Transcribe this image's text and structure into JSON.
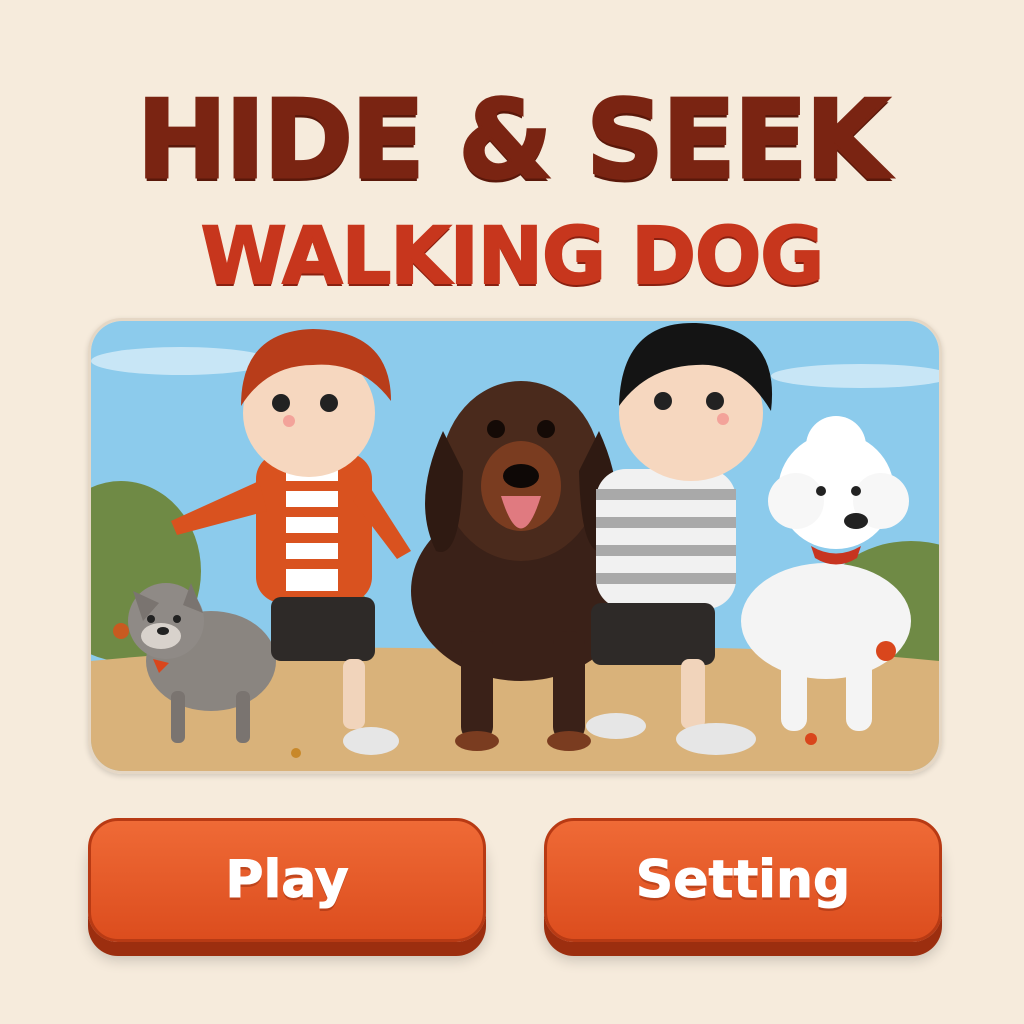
{
  "title": {
    "line1": "HIDE & SEEK",
    "line2": "WALKING DOG"
  },
  "buttons": {
    "play_label": "Play",
    "setting_label": "Setting"
  },
  "colors": {
    "background": "#f6ebdc",
    "title_line1": "#7a2412",
    "title_line2": "#c7361d",
    "button": "#e85a28",
    "button_shadow": "#9c2e0f"
  }
}
